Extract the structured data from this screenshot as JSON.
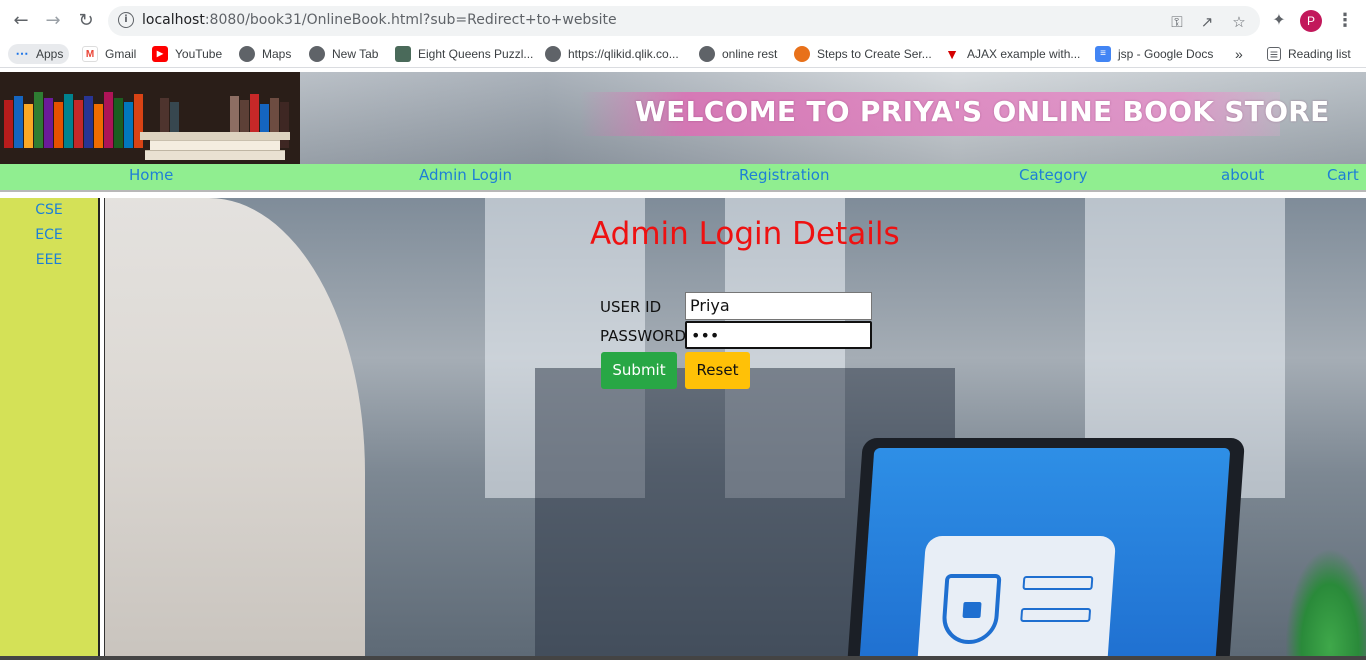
{
  "browser": {
    "url_host": "localhost",
    "url_rest": ":8080/book31/OnlineBook.html?sub=Redirect+to+website",
    "profile_initial": "P",
    "bookmarks": {
      "apps": "Apps",
      "gmail": "Gmail",
      "youtube": "YouTube",
      "maps": "Maps",
      "new_tab": "New Tab",
      "eight_queens": "Eight Queens Puzzl...",
      "qlikid": "https://qlikid.qlik.co...",
      "online_rest": "online rest",
      "steps": "Steps to Create Ser...",
      "ajax": "AJAX example with...",
      "jsp_docs": "jsp - Google Docs",
      "more": "»",
      "reading_list": "Reading list"
    }
  },
  "banner": {
    "title": "WELCOME TO PRIYA'S ONLINE BOOK STORE"
  },
  "navbar": {
    "home": "Home",
    "admin_login": "Admin Login",
    "registration": "Registration",
    "category": "Category",
    "about": "about",
    "cart": "Cart"
  },
  "sidebar": {
    "items": [
      "CSE",
      "ECE",
      "EEE"
    ]
  },
  "login_form": {
    "title": "Admin Login Details",
    "user_id_label": "USER ID",
    "user_id_value": "Priya",
    "password_label": "PASSWORD",
    "password_value": "•••",
    "submit_label": "Submit",
    "reset_label": "Reset"
  },
  "colors": {
    "navbar_bg": "#90ee90",
    "sidebar_bg": "#d4e157",
    "link_color": "#1e7fd6",
    "title_red": "#ee1111",
    "submit_green": "#28a745",
    "reset_yellow": "#ffc107"
  }
}
